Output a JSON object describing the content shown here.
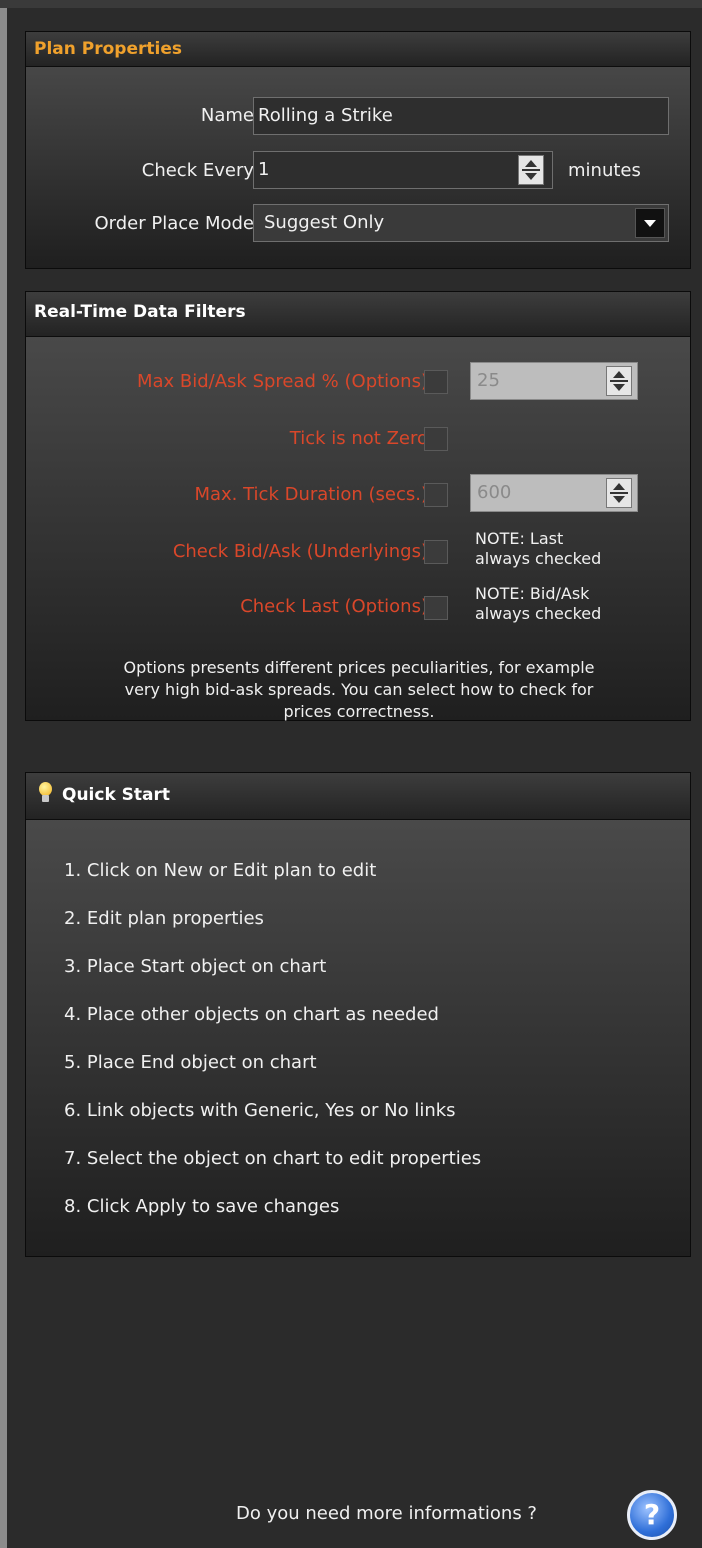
{
  "plan_properties": {
    "title": "Plan Properties",
    "name_label": "Name",
    "name_value": "Rolling a Strike",
    "check_every_label": "Check Every",
    "check_every_value": "1",
    "check_every_unit": "minutes",
    "order_mode_label": "Order Place Mode",
    "order_mode_value": "Suggest Only"
  },
  "filters": {
    "title": "Real-Time Data Filters",
    "max_spread_label": "Max Bid/Ask Spread % (Options)",
    "max_spread_value": "25",
    "tick_not_zero_label": "Tick is not Zero",
    "max_tick_duration_label": "Max. Tick Duration (secs.)",
    "max_tick_duration_value": "600",
    "check_bid_ask_label": "Check Bid/Ask (Underlyings)",
    "check_bid_ask_note_1": "NOTE: Last",
    "check_bid_ask_note_2": "always checked",
    "check_last_label": "Check Last (Options)",
    "check_last_note_1": "NOTE: Bid/Ask",
    "check_last_note_2": "always checked",
    "description_1": "Options presents different prices peculiarities, for example",
    "description_2": "very high bid-ask spreads. You can select how to check for",
    "description_3": "prices correctness.",
    "label_color": "#d9472a"
  },
  "quick_start": {
    "title": "Quick Start",
    "items": [
      "1. Click on New or Edit plan to edit",
      "2. Edit plan properties",
      "3. Place Start object on chart",
      "4. Place other objects on chart as needed",
      "5. Place End object on chart",
      "6. Link objects with Generic, Yes or No links",
      "7. Select the object on chart to edit properties",
      "8. Click Apply to save changes"
    ]
  },
  "footer": {
    "help_text": "Do you need more informations ?",
    "help_icon_glyph": "?"
  }
}
